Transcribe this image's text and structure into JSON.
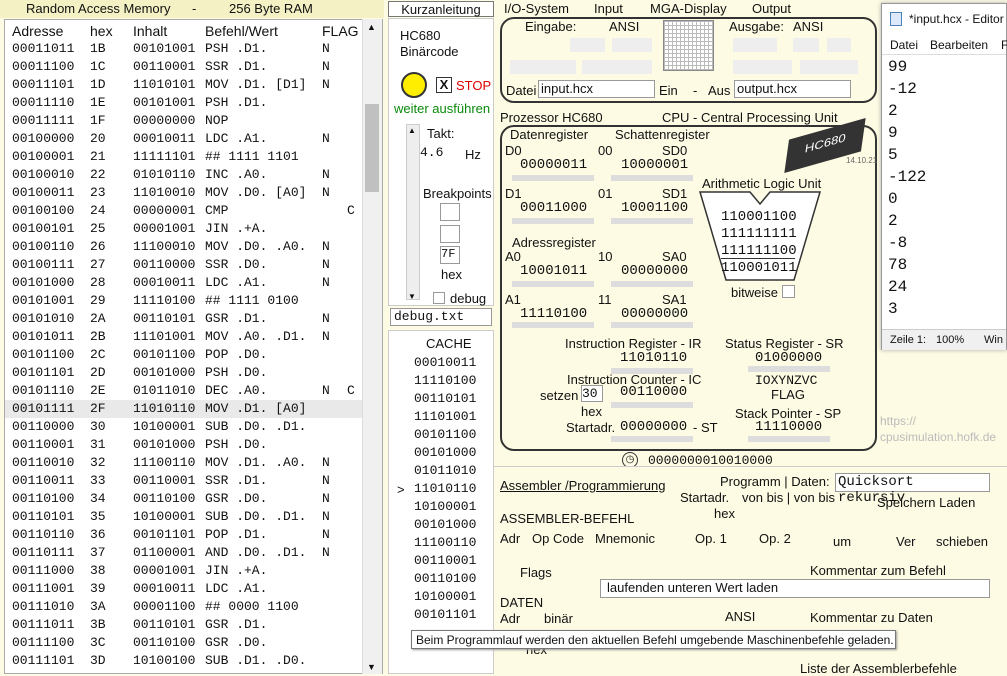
{
  "ram": {
    "title": "Random Access Memory",
    "dash": "-",
    "size": "256 Byte RAM",
    "headers": {
      "adresse": "Adresse",
      "hex": "hex",
      "inhalt": "Inhalt",
      "befehl": "Befehl/Wert",
      "flag": "FLAG"
    },
    "rows": [
      [
        "00011011",
        "1B",
        "00101001",
        "PSH .D1.",
        "N",
        ""
      ],
      [
        "00011100",
        "1C",
        "00110001",
        "SSR .D1.",
        "N",
        ""
      ],
      [
        "00011101",
        "1D",
        "11010101",
        "MOV .D1. [D1]",
        "N",
        ""
      ],
      [
        "00011110",
        "1E",
        "00101001",
        "PSH .D1.",
        "",
        ""
      ],
      [
        "00011111",
        "1F",
        "00000000",
        "NOP",
        "",
        ""
      ],
      [
        "00100000",
        "20",
        "00010011",
        "LDC .A1.",
        "N",
        ""
      ],
      [
        "00100001",
        "21",
        "11111101",
        "## 1111 1101",
        "",
        ""
      ],
      [
        "00100010",
        "22",
        "01010110",
        "INC .A0.",
        "N",
        ""
      ],
      [
        "00100011",
        "23",
        "11010010",
        "MOV .D0. [A0]",
        "N",
        ""
      ],
      [
        "00100100",
        "24",
        "00000001",
        "CMP",
        "",
        "C"
      ],
      [
        "00100101",
        "25",
        "00001001",
        "JIN .+A.",
        "",
        ""
      ],
      [
        "00100110",
        "26",
        "11100010",
        "MOV .D0. .A0.",
        "N",
        ""
      ],
      [
        "00100111",
        "27",
        "00110000",
        "SSR .D0.",
        "N",
        ""
      ],
      [
        "00101000",
        "28",
        "00010011",
        "LDC .A1.",
        "N",
        ""
      ],
      [
        "00101001",
        "29",
        "11110100",
        "## 1111 0100",
        "",
        ""
      ],
      [
        "00101010",
        "2A",
        "00110101",
        "GSR .D1.",
        "N",
        ""
      ],
      [
        "00101011",
        "2B",
        "11101001",
        "MOV .A0. .D1.",
        "N",
        ""
      ],
      [
        "00101100",
        "2C",
        "00101100",
        "POP .D0.",
        "",
        ""
      ],
      [
        "00101101",
        "2D",
        "00101000",
        "PSH .D0.",
        "",
        ""
      ],
      [
        "00101110",
        "2E",
        "01011010",
        "DEC .A0.",
        "N",
        "C"
      ],
      [
        "00101111",
        "2F",
        "11010110",
        "MOV .D1. [A0]",
        "",
        ""
      ],
      [
        "00110000",
        "30",
        "10100001",
        "SUB .D0. .D1.",
        "",
        ""
      ],
      [
        "00110001",
        "31",
        "00101000",
        "PSH .D0.",
        "",
        ""
      ],
      [
        "00110010",
        "32",
        "11100110",
        "MOV .D1. .A0.",
        "N",
        ""
      ],
      [
        "00110011",
        "33",
        "00110001",
        "SSR .D1.",
        "N",
        ""
      ],
      [
        "00110100",
        "34",
        "00110100",
        "GSR .D0.",
        "N",
        ""
      ],
      [
        "00110101",
        "35",
        "10100001",
        "SUB .D0. .D1.",
        "N",
        ""
      ],
      [
        "00110110",
        "36",
        "00101101",
        "POP .D1.",
        "N",
        ""
      ],
      [
        "00110111",
        "37",
        "01100001",
        "AND .D0. .D1.",
        "N",
        ""
      ],
      [
        "00111000",
        "38",
        "00001001",
        "JIN .+A.",
        "",
        ""
      ],
      [
        "00111001",
        "39",
        "00010011",
        "LDC .A1.",
        "",
        ""
      ],
      [
        "00111010",
        "3A",
        "00001100",
        "## 0000 1100",
        "",
        ""
      ],
      [
        "00111011",
        "3B",
        "00110101",
        "GSR .D1.",
        "",
        ""
      ],
      [
        "00111100",
        "3C",
        "00110100",
        "GSR .D0.",
        "",
        ""
      ],
      [
        "00111101",
        "3D",
        "10100100",
        "SUB .D1. .D0.",
        "",
        ""
      ]
    ],
    "selected_index": 20
  },
  "mid": {
    "kurz": "Kurzanleitung",
    "hc680": "HC680",
    "binar": "Binärcode",
    "x": "X",
    "stop": "STOP",
    "weiter": "weiter ausführen",
    "takt": "Takt:",
    "takt_val": "4.6",
    "hz": "Hz",
    "breakpoints": "Breakpoints",
    "bp3": "7F",
    "hex": "hex",
    "debug": "debug",
    "debugfile": "debug.txt",
    "cache_title": "CACHE",
    "cache": [
      "00010011",
      "11110100",
      "00110101",
      "11101001",
      "00101100",
      "00101000",
      "01011010",
      "11010110",
      "10100001",
      "00101000",
      "11100110",
      "00110001",
      "00110100",
      "10100001",
      "00101101"
    ],
    "cache_pointer": ">",
    "cache_ptr_index": 7
  },
  "menu": {
    "io": "I/O-System",
    "input": "Input",
    "mga": "MGA-Display",
    "output": "Output"
  },
  "io": {
    "eingabe": "Eingabe:",
    "ansi1": "ANSI",
    "ausgabe": "Ausgabe:",
    "ansi2": "ANSI",
    "datei": "Datei",
    "infile": "input.hcx",
    "ein": "Ein",
    "dash": "-",
    "aus": "Aus",
    "outfile": "output.hcx"
  },
  "cpu": {
    "prozessor": "Prozessor HC680",
    "cputitle": "CPU - Central Processing Unit",
    "datenreg": "Datenregister",
    "schatten": "Schattenregister",
    "d0": "D0",
    "n00": "00",
    "sd0": "SD0",
    "d0v": "00000011",
    "sd0v": "10000001",
    "d1": "D1",
    "n01": "01",
    "sd1": "SD1",
    "d1v": "00011000",
    "sd1v": "10001100",
    "adressreg": "Adressregister",
    "a0": "A0",
    "n10": "10",
    "sa0": "SA0",
    "a0v": "10001011",
    "sa0v": "00000000",
    "a1": "A1",
    "n11": "11",
    "sa1": "SA1",
    "a1v": "11110100",
    "sa1v": "00000000",
    "alu": "Arithmetic Logic Unit",
    "alu1": "110001100",
    "alu2": "111111111",
    "alu3": "111111100",
    "alu4": "110001011",
    "bitweise": "bitweise",
    "ir": "Instruction Register - IR",
    "irv": "11010110",
    "sr": "Status Register - SR",
    "srv": "01000000",
    "srflags": "IOXYNZVC",
    "flag": "FLAG",
    "ic": "Instruction Counter - IC",
    "setzen": "setzen",
    "setzv": "30",
    "icv": "00110000",
    "hex": "hex",
    "sp": "Stack Pointer - SP",
    "spv": "11110000",
    "startadr": "Startadr.",
    "stv": "00000000",
    "st": "- ST",
    "chip": "HC680",
    "chipdate": "14.10.21",
    "clock": "0000000010010000",
    "url1": "https://",
    "url2": "cpusimulation.hofk.de"
  },
  "asm": {
    "link": "Assembler /Programmierung",
    "programm": "Programm | Daten:",
    "progname": "Quicksort rekursiv",
    "startadr": "Startadr.",
    "hex": "hex",
    "vonbis": "von bis | von bis",
    "speichern": "Speichern Laden",
    "befehl": "ASSEMBLER-BEFEHL",
    "adr": "Adr",
    "opcode": "Op Code",
    "mnemonic": "Mnemonic",
    "op1": "Op. 1",
    "op2": "Op. 2",
    "um": "um",
    "ver": "Ver",
    "schieben": "schieben",
    "flags": "Flags",
    "kommentar": "Kommentar zum Befehl",
    "kommval": "laufenden unteren Wert laden",
    "daten": "DATEN",
    "dadr": "Adr",
    "binar": "binär",
    "ansi": "ANSI",
    "kommd": "Kommentar zu Daten",
    "dhex": "hex",
    "liste": "Liste der Assemblerbefehle"
  },
  "notepad": {
    "title": "*input.hcx - Editor",
    "menu": [
      "Datei",
      "Bearbeiten",
      "F"
    ],
    "lines": [
      "99",
      "-12",
      "2",
      "9",
      "5",
      "-122",
      "0",
      "2",
      "-8",
      "78",
      "24",
      "3"
    ],
    "status": [
      "Zeile 1:",
      "100%",
      "Win"
    ]
  },
  "tooltip": "Beim Programmlauf werden den aktuellen Befehl umgebende Maschinenbefehle geladen."
}
